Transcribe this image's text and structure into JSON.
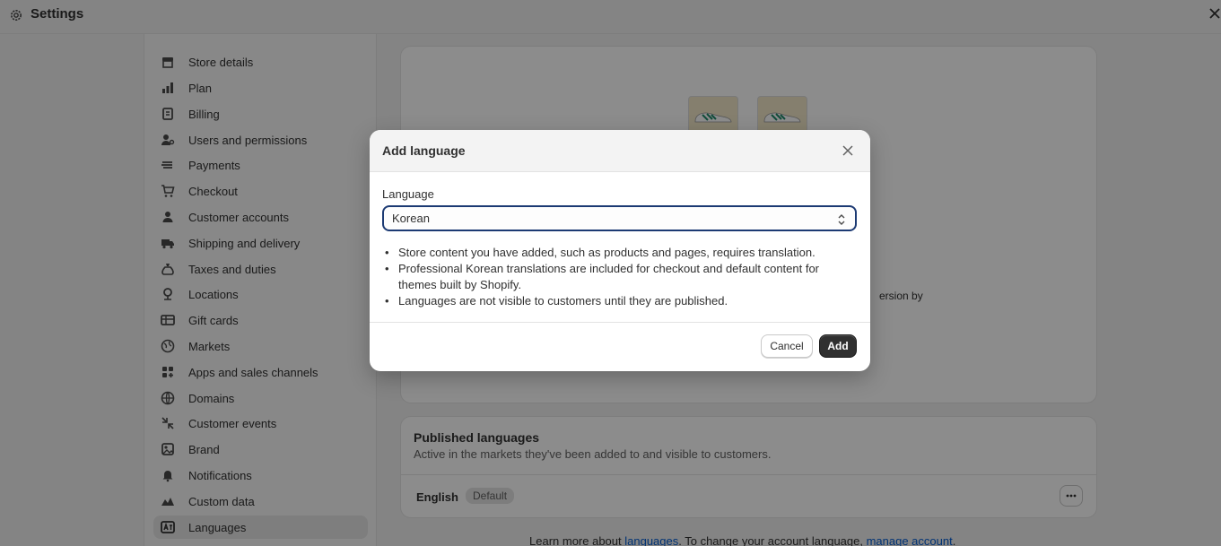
{
  "topbar": {
    "title": "Settings"
  },
  "sidebar": {
    "items": [
      {
        "label": "Store details",
        "icon": "store-icon"
      },
      {
        "label": "Plan",
        "icon": "plan-icon"
      },
      {
        "label": "Billing",
        "icon": "billing-icon"
      },
      {
        "label": "Users and permissions",
        "icon": "users-icon"
      },
      {
        "label": "Payments",
        "icon": "payments-icon"
      },
      {
        "label": "Checkout",
        "icon": "cart-icon"
      },
      {
        "label": "Customer accounts",
        "icon": "person-icon"
      },
      {
        "label": "Shipping and delivery",
        "icon": "truck-icon"
      },
      {
        "label": "Taxes and duties",
        "icon": "tax-icon"
      },
      {
        "label": "Locations",
        "icon": "location-icon"
      },
      {
        "label": "Gift cards",
        "icon": "gift-card-icon"
      },
      {
        "label": "Markets",
        "icon": "globe-icon"
      },
      {
        "label": "Apps and sales channels",
        "icon": "apps-icon"
      },
      {
        "label": "Domains",
        "icon": "globe-icon"
      },
      {
        "label": "Customer events",
        "icon": "events-icon"
      },
      {
        "label": "Brand",
        "icon": "brand-icon"
      },
      {
        "label": "Notifications",
        "icon": "bell-icon"
      },
      {
        "label": "Custom data",
        "icon": "data-icon"
      },
      {
        "label": "Languages",
        "icon": "language-icon"
      }
    ],
    "active_index": 18
  },
  "main": {
    "partial_text": "ersion by",
    "published": {
      "title": "Published languages",
      "subtitle": "Active in the markets they've been added to and visible to customers.",
      "language": "English",
      "badge": "Default"
    },
    "footer": {
      "prefix": "Learn more about ",
      "link1": "languages",
      "middle": ". To change your account language, ",
      "link2": "manage account",
      "suffix": "."
    }
  },
  "modal": {
    "title": "Add language",
    "field_label": "Language",
    "selected_language": "Korean",
    "bullets": [
      "Store content you have added, such as products and pages, requires translation.",
      "Professional Korean translations are included for checkout and default content for themes built by Shopify.",
      "Languages are not visible to customers until they are published."
    ],
    "cancel_label": "Cancel",
    "add_label": "Add"
  },
  "colors": {
    "primary_button": "#303030",
    "focus_border": "#1c3a73",
    "link": "#005bd3"
  }
}
